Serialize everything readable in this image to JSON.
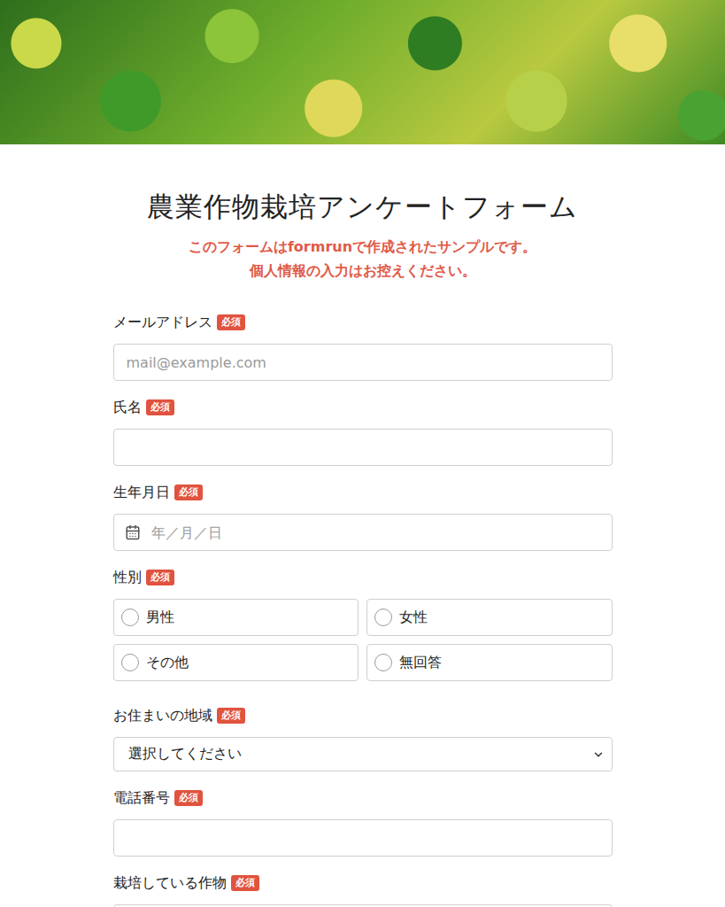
{
  "banner": {
    "kind": "photo"
  },
  "title": "農業作物栽培アンケートフォーム",
  "notice": [
    "このフォームはformrunで作成されたサンプルです。",
    "個人情報の入力はお控えください。"
  ],
  "required_badge": "必須",
  "fields": [
    {
      "label": "メールアドレス",
      "required": true,
      "kind": "text",
      "placeholder": "mail@example.com",
      "value": ""
    },
    {
      "label": "氏名",
      "required": true,
      "kind": "text",
      "placeholder": "",
      "value": ""
    },
    {
      "label": "生年月日",
      "required": true,
      "kind": "date",
      "placeholder": "年／月／日",
      "value": ""
    },
    {
      "label": "性別",
      "required": true,
      "kind": "radio",
      "options": [
        {
          "label": "男性",
          "selected": false
        },
        {
          "label": "女性",
          "selected": false
        },
        {
          "label": "その他",
          "selected": false
        },
        {
          "label": "無回答",
          "selected": false
        }
      ]
    },
    {
      "label": "お住まいの地域",
      "required": true,
      "kind": "select",
      "placeholder": "選択してください"
    },
    {
      "label": "電話番号",
      "required": true,
      "kind": "text",
      "placeholder": "",
      "value": ""
    },
    {
      "label": "栽培している作物",
      "required": true,
      "kind": "text",
      "placeholder": "",
      "value": ""
    }
  ]
}
